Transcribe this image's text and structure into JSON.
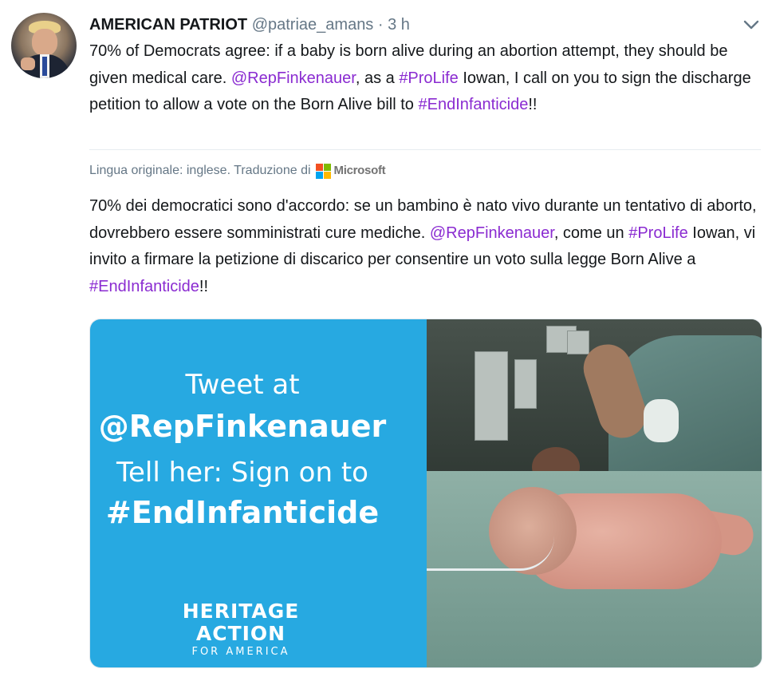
{
  "tweet": {
    "author_name": "AMERICAN PATRIOT",
    "handle": "@patriae_amans",
    "separator": "·",
    "time": "3 h",
    "text": [
      {
        "t": "70% of Democrats agree: if a baby is born alive during an abortion attempt, they should be given medical care. ",
        "link": false
      },
      {
        "t": "@RepFinkenauer",
        "link": true
      },
      {
        "t": ", as a ",
        "link": false
      },
      {
        "t": "#ProLife",
        "link": true
      },
      {
        "t": " Iowan, I call on you to sign the discharge petition to allow a vote on the Born Alive bill to ",
        "link": false
      },
      {
        "t": "#EndInfanticide",
        "link": true
      },
      {
        "t": "!!",
        "link": false
      }
    ]
  },
  "translation": {
    "label": "Lingua originale: inglese. Traduzione di",
    "provider": "Microsoft",
    "text": [
      {
        "t": "70% dei democratici sono d'accordo: se un bambino è nato vivo durante un tentativo di aborto, dovrebbero essere somministrati cure mediche. ",
        "link": false
      },
      {
        "t": "@RepFinkenauer",
        "link": true
      },
      {
        "t": ", come un ",
        "link": false
      },
      {
        "t": "#ProLife",
        "link": true
      },
      {
        "t": " Iowan, vi invito a firmare la petizione di discarico per consentire un voto sulla legge Born Alive a ",
        "link": false
      },
      {
        "t": "#EndInfanticide",
        "link": true
      },
      {
        "t": "!!",
        "link": false
      }
    ]
  },
  "media": {
    "line1": "Tweet at",
    "line2": "@RepFinkenauer",
    "line3": "Tell her: Sign on to",
    "line4": "#EndInfanticide",
    "logo_line1": "HERITAGE",
    "logo_line2": "ACTION",
    "logo_line3": "FOR AMERICA"
  },
  "icons": {
    "caret": "chevron-down-icon",
    "translator_logo": "microsoft-logo-icon"
  },
  "colors": {
    "link": "#8a2bd1",
    "muted": "#657786",
    "media_blue": "#27a9e1",
    "ms_red": "#f25022",
    "ms_green": "#7fba00",
    "ms_blue": "#00a4ef",
    "ms_yellow": "#ffb900"
  }
}
